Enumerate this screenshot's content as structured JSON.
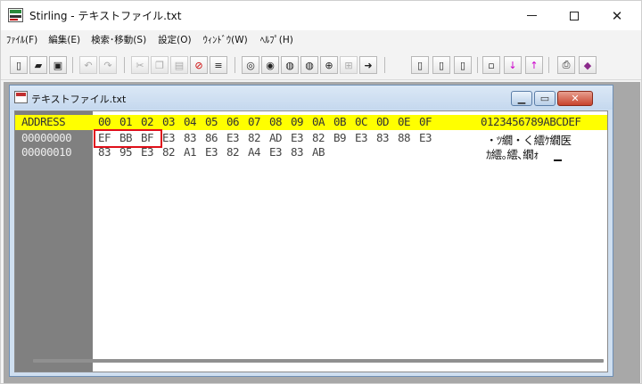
{
  "window": {
    "title": "Stirling - テキストファイル.txt",
    "controls": {
      "minimize": "—",
      "maximize": "□",
      "close": "✕"
    }
  },
  "menu": [
    "ﾌｧｲﾙ(F)",
    "編集(E)",
    "検索･移動(S)",
    "設定(O)",
    "ｳｨﾝﾄﾞｳ(W)",
    "ﾍﾙﾌﾟ(H)"
  ],
  "toolbar": [
    "new-icon",
    "open-icon",
    "save-icon",
    "undo-icon",
    "redo-icon",
    "cut-icon",
    "copy-icon",
    "paste-icon",
    "delete-icon",
    "insert-icon",
    "find-icon",
    "find-prev-icon",
    "find-next-icon",
    "find-next-2-icon",
    "replace-icon",
    "replace-all-icon",
    "jump-icon",
    "block-start-icon",
    "block-end-icon",
    "block-select-icon",
    "mode-icon",
    "move-down-icon",
    "move-up-icon",
    "print-icon",
    "help-icon"
  ],
  "child": {
    "title": "テキストファイル.txt"
  },
  "hex": {
    "header": {
      "address": "ADDRESS",
      "columns": [
        "00",
        "01",
        "02",
        "03",
        "04",
        "05",
        "06",
        "07",
        "08",
        "09",
        "0A",
        "0B",
        "0C",
        "0D",
        "0E",
        "0F"
      ],
      "text": "0123456789ABCDEF"
    },
    "rows": [
      {
        "address": "00000000",
        "bytes": [
          "EF",
          "BB",
          "BF",
          "E3",
          "83",
          "86",
          "E3",
          "82",
          "AD",
          "E3",
          "82",
          "B9",
          "E3",
          "83",
          "88",
          "E3"
        ],
        "text": "・ﾂ繝・く繧ｹ繝医"
      },
      {
        "address": "00000010",
        "bytes": [
          "83",
          "95",
          "E3",
          "82",
          "A1",
          "E3",
          "82",
          "A4",
          "E3",
          "83",
          "AB",
          "",
          "",
          "",
          "",
          ""
        ],
        "text": "ｶ繧｡繧､繝ｫ"
      }
    ]
  },
  "colors": {
    "header_highlight": "#ffff00",
    "selection_box": "#e0101a",
    "address_column": "#808080"
  }
}
